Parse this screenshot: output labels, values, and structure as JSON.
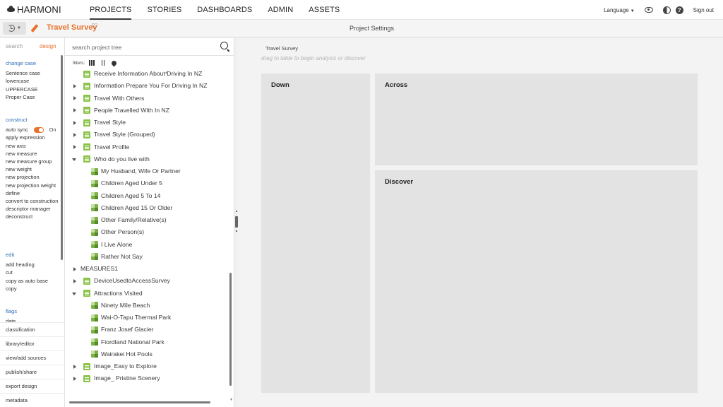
{
  "app": {
    "logo": "HARMONI"
  },
  "nav": {
    "links": [
      "PROJECTS",
      "STORIES",
      "DASHBOARDS",
      "ADMIN",
      "ASSETS"
    ],
    "language": "Language",
    "signout": "Sign out"
  },
  "subbar": {
    "project_title": "Travel Survey",
    "page_title": "Project Settings"
  },
  "leftbar": {
    "tabs": {
      "search": "search",
      "design": "design"
    },
    "change_case": {
      "head": "change case",
      "items": [
        "Sentence case",
        "lowercase",
        "UPPERCASE",
        "Proper Case"
      ]
    },
    "construct": {
      "head": "construct",
      "autosync_label": "auto sync",
      "autosync_state": "On",
      "items": [
        "apply expression",
        "new axis",
        "new measure",
        "new measure group",
        "new weight",
        "new projection",
        "new projection weight",
        "define",
        "convert to construction",
        "descriptor manager",
        "deconstruct"
      ]
    },
    "edit": {
      "head": "edit",
      "items": [
        "add heading",
        "cut",
        "copy as auto base",
        "copy"
      ]
    },
    "flags": {
      "head": "flags",
      "partial": "date"
    },
    "footer": [
      "classification",
      "library/editor",
      "view/add sources",
      "publish/share",
      "export design",
      "metadata"
    ]
  },
  "tree": {
    "search_placeholder": "search project tree",
    "filters_label": "filters:",
    "rows": [
      {
        "label": "Receive Information About Driving In NZ",
        "level": 0,
        "arrow": "none",
        "icon": "table"
      },
      {
        "label": "Information Prepare You For Driving In NZ",
        "level": 0,
        "arrow": "right",
        "icon": "table"
      },
      {
        "label": "Travel With Others",
        "level": 0,
        "arrow": "right",
        "icon": "table"
      },
      {
        "label": "People Travelled With In NZ",
        "level": 0,
        "arrow": "right",
        "icon": "table"
      },
      {
        "label": "Travel Style",
        "level": 0,
        "arrow": "right",
        "icon": "table"
      },
      {
        "label": "Travel Style (Grouped)",
        "level": 0,
        "arrow": "right",
        "icon": "table"
      },
      {
        "label": "Travel Profile",
        "level": 0,
        "arrow": "right",
        "icon": "table"
      },
      {
        "label": "Who do you live with",
        "level": 0,
        "arrow": "down",
        "icon": "table"
      },
      {
        "label": "My Husband, Wife Or Partner",
        "level": 1,
        "arrow": "none",
        "icon": "item"
      },
      {
        "label": "Children Aged Under 5",
        "level": 1,
        "arrow": "none",
        "icon": "item"
      },
      {
        "label": "Children Aged 5 To 14",
        "level": 1,
        "arrow": "none",
        "icon": "item"
      },
      {
        "label": "Children Aged 15 Or Older",
        "level": 1,
        "arrow": "none",
        "icon": "item"
      },
      {
        "label": "Other Family/Relative(s)",
        "level": 1,
        "arrow": "none",
        "icon": "item"
      },
      {
        "label": "Other Person(s)",
        "level": 1,
        "arrow": "none",
        "icon": "item"
      },
      {
        "label": "I Live Alone",
        "level": 1,
        "arrow": "none",
        "icon": "item"
      },
      {
        "label": "Rather Not Say",
        "level": 1,
        "arrow": "none",
        "icon": "item"
      },
      {
        "label": "MEASURES1",
        "level": 0,
        "arrow": "right",
        "icon": "none"
      },
      {
        "label": "DeviceUsedtoAccessSurvey",
        "level": 0,
        "arrow": "right",
        "icon": "table"
      },
      {
        "label": "Attractions Visited",
        "level": 0,
        "arrow": "down",
        "icon": "table"
      },
      {
        "label": "Ninety Mile Beach",
        "level": 1,
        "arrow": "none",
        "icon": "item"
      },
      {
        "label": "Wai-O-Tapu Thermal Park",
        "level": 1,
        "arrow": "none",
        "icon": "item"
      },
      {
        "label": "Franz Josef Glacier",
        "level": 1,
        "arrow": "none",
        "icon": "item"
      },
      {
        "label": "Fiordland National Park",
        "level": 1,
        "arrow": "none",
        "icon": "item"
      },
      {
        "label": "Wairakei Hot Pools",
        "level": 1,
        "arrow": "none",
        "icon": "item"
      },
      {
        "label": "Image_Easy to Explore",
        "level": 0,
        "arrow": "right",
        "icon": "table"
      },
      {
        "label": "Image_ Pristine Scenery",
        "level": 0,
        "arrow": "right",
        "icon": "table"
      }
    ]
  },
  "canvas": {
    "title": "Travel Survey",
    "hint": "drag to table to begin analysis or discover",
    "down": "Down",
    "across": "Across",
    "discover": "Discover"
  },
  "colors": {
    "accent": "#e8712a",
    "link": "#2c6fb8",
    "icon_green": "#8bc34a"
  }
}
